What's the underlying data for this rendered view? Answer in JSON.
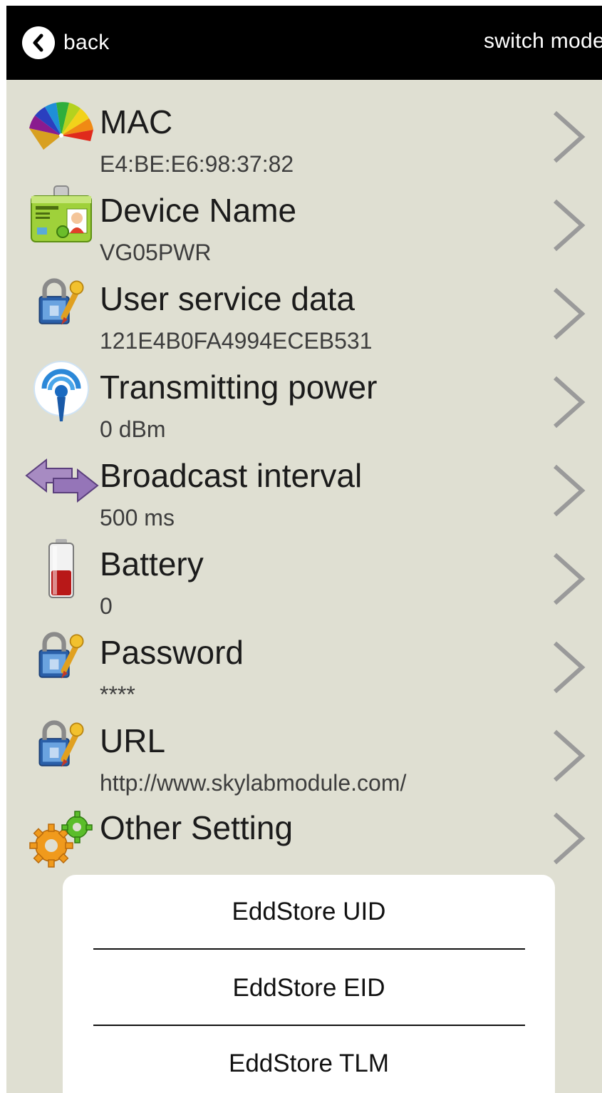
{
  "header": {
    "back_label": "back",
    "switch_mode_label": "switch mode"
  },
  "colors": {
    "background": "#dfdfd2",
    "topbar": "#000000",
    "chevron": "#9a9a9a"
  },
  "rows": [
    {
      "title": "MAC",
      "value": "E4:BE:E6:98:37:82",
      "icon": "color-fan-icon"
    },
    {
      "title": "Device Name",
      "value": "VG05PWR",
      "icon": "id-card-icon"
    },
    {
      "title": "User service data",
      "value": "121E4B0FA4994ECEB531",
      "icon": "lock-key-icon"
    },
    {
      "title": "Transmitting power",
      "value": "0 dBm",
      "icon": "signal-tower-icon"
    },
    {
      "title": "Broadcast interval",
      "value": "500 ms",
      "icon": "double-arrow-icon"
    },
    {
      "title": "Battery",
      "value": "0",
      "icon": "battery-icon"
    },
    {
      "title": "Password",
      "value": "****",
      "icon": "lock-key-icon"
    },
    {
      "title": "URL",
      "value": "http://www.skylabmodule.com/",
      "icon": "lock-key-icon"
    },
    {
      "title": "Other Setting",
      "value": "",
      "icon": "gears-icon"
    }
  ],
  "popup": {
    "options": [
      "EddStore UID",
      "EddStore EID",
      "EddStore TLM"
    ]
  }
}
